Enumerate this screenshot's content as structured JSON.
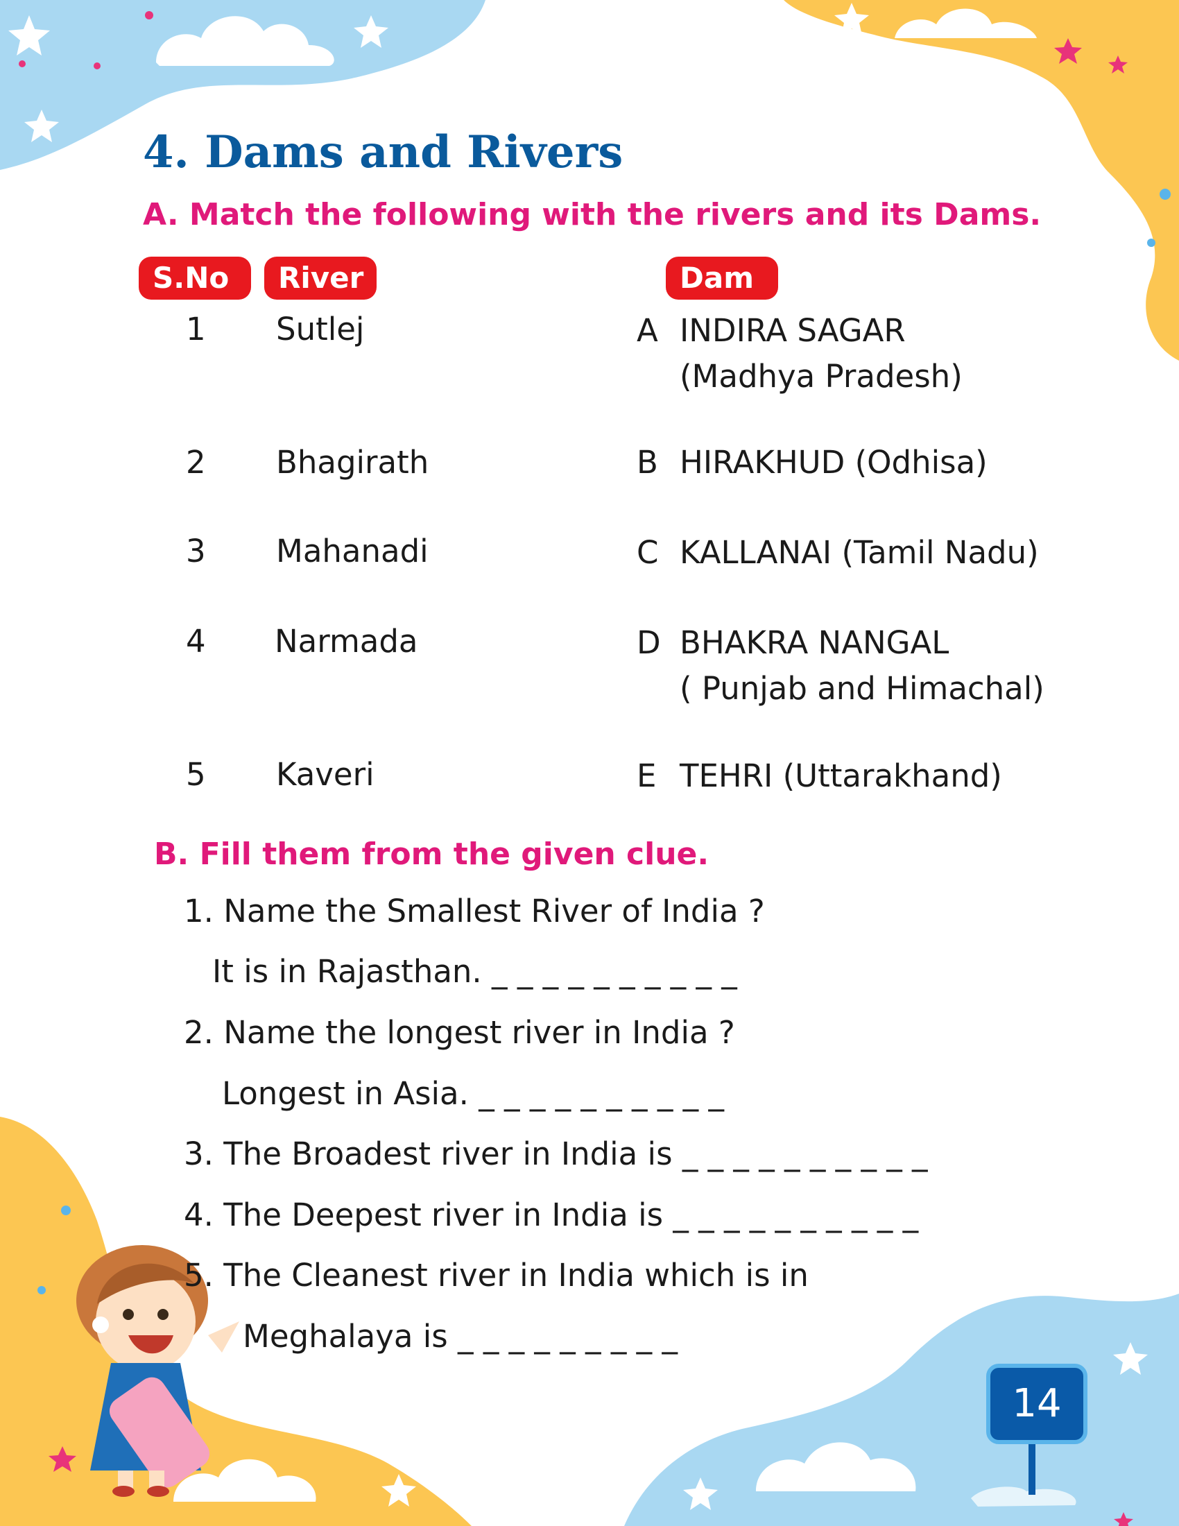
{
  "title": "4. Dams and Rivers",
  "section_a": {
    "heading": "A. Match the following with the rivers and its Dams.",
    "col_sno": "S.No",
    "col_river": "River",
    "col_dam": "Dam",
    "rows": [
      {
        "no": "1",
        "river": "Sutlej",
        "letter": "A",
        "dam1": "INDIRA SAGAR",
        "dam2": "(Madhya Pradesh)"
      },
      {
        "no": "2",
        "river": "Bhagirath",
        "letter": "B",
        "dam1": "HIRAKHUD (Odhisa)",
        "dam2": ""
      },
      {
        "no": "3",
        "river": "Mahanadi",
        "letter": "C",
        "dam1": "KALLANAI (Tamil Nadu)",
        "dam2": ""
      },
      {
        "no": "4",
        "river": "Narmada",
        "letter": "D",
        "dam1": "BHAKRA NANGAL",
        "dam2": "( Punjab and Himachal)"
      },
      {
        "no": "5",
        "river": "Kaveri",
        "letter": "E",
        "dam1": "TEHRI (Uttarakhand)",
        "dam2": ""
      }
    ]
  },
  "section_b": {
    "heading": "B. Fill them from the given clue.",
    "lines": [
      "1. Name the Smallest River of India ?",
      "It is in Rajasthan. _ _ _ _ _ _ _ _ _ _",
      "2. Name the longest river in India ?",
      "Longest in Asia. _ _ _ _ _ _ _ _ _ _",
      "3. The Broadest river in India is _ _ _ _ _ _ _ _ _ _",
      "4. The Deepest river in India is  _ _ _ _ _ _ _ _ _ _",
      "5. The Cleanest river in India which is in",
      "Meghalaya is _ _ _ _ _ _ _ _ _"
    ]
  },
  "page_number": "14",
  "colors": {
    "title": "#0a5a9c",
    "section_heading": "#e0197a",
    "pill": "#e8191f",
    "sky_blue": "#a9d8f2",
    "sun_yellow": "#fcc652",
    "page_badge": "#0a5aa8"
  }
}
